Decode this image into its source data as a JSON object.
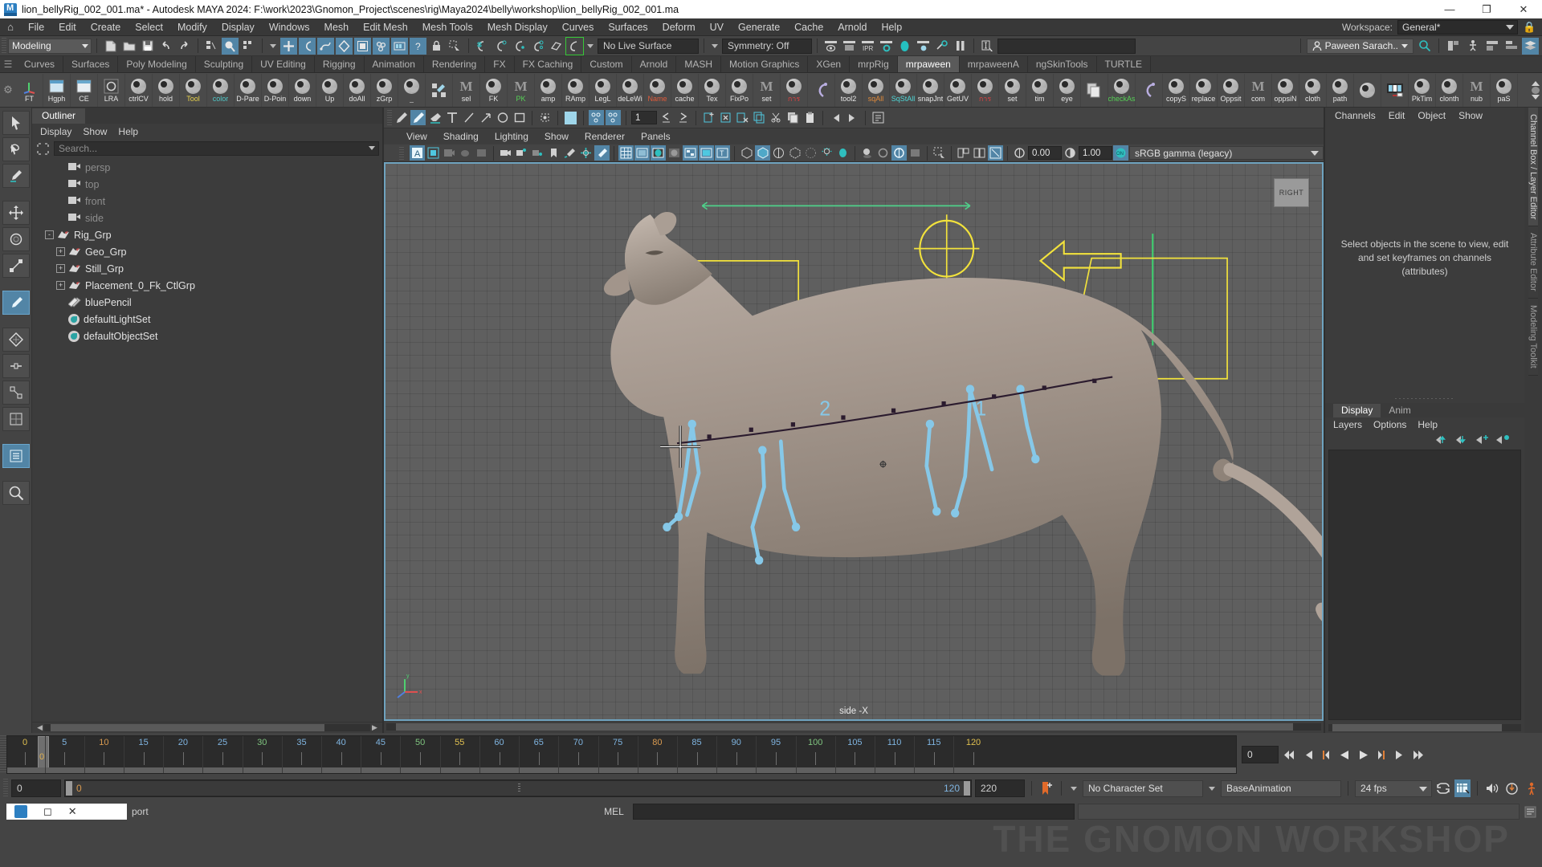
{
  "window": {
    "title": "lion_bellyRig_002_001.ma* - Autodesk MAYA 2024: F:\\work\\2023\\Gnomon_Project\\scenes\\rig\\Maya2024\\belly\\workshop\\lion_bellyRig_002_001.ma",
    "minimize": "—",
    "maximize": "❐",
    "close": "✕",
    "app_icon": "maya-logo-icon"
  },
  "menubar": {
    "home_icon": "home-icon",
    "items": [
      "File",
      "Edit",
      "Create",
      "Select",
      "Modify",
      "Display",
      "Windows",
      "Mesh",
      "Edit Mesh",
      "Mesh Tools",
      "Mesh Display",
      "Curves",
      "Surfaces",
      "Deform",
      "UV",
      "Generate",
      "Cache",
      "Arnold",
      "Help"
    ],
    "workspace_label": "Workspace:",
    "workspace_value": "General*",
    "lock_icon": "lock-icon"
  },
  "statusbar": {
    "mode": "Modeling",
    "live_surface": "No Live Surface",
    "symmetry": "Symmetry: Off",
    "search_value": "",
    "user": "Paween Sarach..",
    "new_icon": "new-scene-icon",
    "open_icon": "open-scene-icon",
    "save_icon": "save-scene-icon",
    "undo_icon": "undo-icon",
    "redo_icon": "redo-icon"
  },
  "shelf": {
    "tabs": [
      "Curves",
      "Surfaces",
      "Poly Modeling",
      "Sculpting",
      "UV Editing",
      "Rigging",
      "Animation",
      "Rendering",
      "FX",
      "FX Caching",
      "Custom",
      "Arnold",
      "MASH",
      "Motion Graphics",
      "XGen",
      "mrpRig",
      "mrpaween",
      "mrpaweenA",
      "ngSkinTools",
      "TURTLE"
    ],
    "active_tab": "mrpaween",
    "buttons": [
      {
        "label": "FT",
        "icon": "axis-icon",
        "color": "#e6e6e6"
      },
      {
        "label": "Hgph",
        "icon": "hypergraph-icon",
        "color": "#e6e6e6"
      },
      {
        "label": "CE",
        "icon": "component-editor-icon",
        "color": "#e6e6e6"
      },
      {
        "label": "LRA",
        "icon": "lra-icon",
        "color": "#e6e6e6"
      },
      {
        "label": "ctrlCV",
        "icon": "maya-script-icon",
        "color": "#e6e6e6"
      },
      {
        "label": "hold",
        "icon": "maya-script-icon",
        "color": "#e6e6e6"
      },
      {
        "label": "Tool",
        "icon": "maya-script-icon",
        "color": "#e8d24a"
      },
      {
        "label": "color",
        "icon": "maya-script-icon",
        "color": "#4fc8c8"
      },
      {
        "label": "D-Pare",
        "icon": "maya-script-icon",
        "color": "#e6e6e6"
      },
      {
        "label": "D-Poin",
        "icon": "maya-script-icon",
        "color": "#e6e6e6"
      },
      {
        "label": "down",
        "icon": "maya-script-icon",
        "color": "#e6e6e6"
      },
      {
        "label": "Up",
        "icon": "maya-script-icon",
        "color": "#e6e6e6"
      },
      {
        "label": "doAll",
        "icon": "maya-script-icon",
        "color": "#e6e6e6"
      },
      {
        "label": "zGrp",
        "icon": "maya-script-icon",
        "color": "#e6e6e6"
      },
      {
        "label": "_",
        "icon": "maya-script-icon",
        "color": "#e6e6e6"
      },
      {
        "label": "",
        "icon": "paint-select-icon",
        "color": "#e6e6e6"
      },
      {
        "label": "sel",
        "icon": "mel-icon",
        "color": "#e6e6e6"
      },
      {
        "label": "FK",
        "icon": "maya-script-icon",
        "color": "#e6e6e6"
      },
      {
        "label": "PK",
        "icon": "mel-icon",
        "color": "#56d156"
      },
      {
        "label": "amp",
        "icon": "maya-script-icon",
        "color": "#e6e6e6"
      },
      {
        "label": "RAmp",
        "icon": "maya-script-icon",
        "color": "#e6e6e6"
      },
      {
        "label": "LegL",
        "icon": "maya-script-icon",
        "color": "#e6e6e6"
      },
      {
        "label": "deLeWi",
        "icon": "maya-script-icon",
        "color": "#e6e6e6"
      },
      {
        "label": "Name",
        "icon": "maya-script-icon",
        "color": "#e05b3a"
      },
      {
        "label": "cache",
        "icon": "maya-script-icon",
        "color": "#e6e6e6"
      },
      {
        "label": "Tex",
        "icon": "maya-script-icon",
        "color": "#e6e6e6"
      },
      {
        "label": "FixPo",
        "icon": "maya-script-icon",
        "color": "#e6e6e6"
      },
      {
        "label": "set",
        "icon": "mel-icon",
        "color": "#e6e6e6"
      },
      {
        "label": "การ",
        "icon": "maya-script-icon",
        "color": "#e04040"
      },
      {
        "label": "",
        "icon": "curve-icon",
        "color": "#e6e6e6"
      },
      {
        "label": "tool2",
        "icon": "maya-script-icon",
        "color": "#e6e6e6"
      },
      {
        "label": "sqAll",
        "icon": "maya-script-icon",
        "color": "#e08a3a"
      },
      {
        "label": "SqStAll",
        "icon": "maya-script-icon",
        "color": "#4fd8d8"
      },
      {
        "label": "snapJnt",
        "icon": "maya-script-icon",
        "color": "#e6e6e6"
      },
      {
        "label": "GetUV",
        "icon": "maya-script-icon",
        "color": "#e6e6e6"
      },
      {
        "label": "การ",
        "icon": "maya-script-icon",
        "color": "#e04040"
      },
      {
        "label": "set",
        "icon": "maya-script-icon",
        "color": "#e6e6e6"
      },
      {
        "label": "tim",
        "icon": "maya-script-icon",
        "color": "#e6e6e6"
      },
      {
        "label": "eye",
        "icon": "maya-script-icon",
        "color": "#e6e6e6"
      },
      {
        "label": "",
        "icon": "copy-icon",
        "color": "#e6e6e6"
      },
      {
        "label": "checkAs",
        "icon": "maya-script-icon",
        "color": "#56d156"
      },
      {
        "label": "",
        "icon": "curve-icon",
        "color": "#e6e6e6"
      },
      {
        "label": "copyS",
        "icon": "maya-script-icon",
        "color": "#e6e6e6"
      },
      {
        "label": "replace",
        "icon": "maya-script-icon",
        "color": "#e6e6e6"
      },
      {
        "label": "Oppsit",
        "icon": "maya-script-icon",
        "color": "#e6e6e6"
      },
      {
        "label": "com",
        "icon": "mel-icon",
        "color": "#e6e6e6"
      },
      {
        "label": "oppsiN",
        "icon": "maya-script-icon",
        "color": "#e6e6e6"
      },
      {
        "label": "cloth",
        "icon": "maya-script-icon",
        "color": "#e6e6e6"
      },
      {
        "label": "path",
        "icon": "maya-script-icon",
        "color": "#e6e6e6"
      },
      {
        "label": "",
        "icon": "maya-script-icon",
        "color": "#e6e6e6"
      },
      {
        "label": "",
        "icon": "film-icon",
        "color": "#e6e6e6"
      },
      {
        "label": "PkTim",
        "icon": "maya-script-icon",
        "color": "#e6e6e6"
      },
      {
        "label": "clonth",
        "icon": "maya-script-icon",
        "color": "#e6e6e6"
      },
      {
        "label": "nub",
        "icon": "mel-icon",
        "color": "#e6e6e6"
      },
      {
        "label": "paS",
        "icon": "maya-script-icon",
        "color": "#e6e6e6"
      }
    ]
  },
  "toolbox": {
    "tools": [
      {
        "name": "select-tool-icon",
        "selected": false
      },
      {
        "name": "lasso-select-tool-icon",
        "selected": false
      },
      {
        "name": "paint-select-tool-icon",
        "selected": false
      },
      {
        "name": "move-tool-icon",
        "selected": false
      },
      {
        "name": "rotate-tool-icon",
        "selected": false
      },
      {
        "name": "scale-tool-icon",
        "selected": false
      },
      {
        "name": "last-tool-icon",
        "selected": true
      },
      {
        "name": "transform-icon",
        "selected": false
      },
      {
        "name": "snap-grid-icon",
        "selected": false
      },
      {
        "name": "snap-curve-icon",
        "selected": false
      },
      {
        "name": "snap-point-icon",
        "selected": false
      },
      {
        "name": "outliner-icon",
        "selected": true
      },
      {
        "name": "magnify-icon",
        "selected": false
      }
    ]
  },
  "outliner": {
    "tab": "Outliner",
    "menus": [
      "Display",
      "Show",
      "Help"
    ],
    "search_placeholder": "Search...",
    "filter_icon": "filter-icon",
    "items": [
      {
        "label": "persp",
        "icon": "camera-icon",
        "indent": 1,
        "dim": true,
        "expander": ""
      },
      {
        "label": "top",
        "icon": "camera-icon",
        "indent": 1,
        "dim": true,
        "expander": ""
      },
      {
        "label": "front",
        "icon": "camera-icon",
        "indent": 1,
        "dim": true,
        "expander": ""
      },
      {
        "label": "side",
        "icon": "camera-icon",
        "indent": 1,
        "dim": true,
        "expander": ""
      },
      {
        "label": "Rig_Grp",
        "icon": "group-icon",
        "indent": 0,
        "dim": false,
        "expander": "-"
      },
      {
        "label": "Geo_Grp",
        "icon": "group-icon",
        "indent": 1,
        "dim": false,
        "expander": "+"
      },
      {
        "label": "Still_Grp",
        "icon": "group-icon",
        "indent": 1,
        "dim": false,
        "expander": "+"
      },
      {
        "label": "Placement_0_Fk_CtlGrp",
        "icon": "group-icon",
        "indent": 1,
        "dim": false,
        "expander": "+"
      },
      {
        "label": "bluePencil",
        "icon": "blue-pencil-icon",
        "indent": 1,
        "dim": false,
        "expander": ""
      },
      {
        "label": "defaultLightSet",
        "icon": "set-icon",
        "indent": 1,
        "dim": false,
        "expander": ""
      },
      {
        "label": "defaultObjectSet",
        "icon": "set-icon",
        "indent": 1,
        "dim": false,
        "expander": ""
      }
    ]
  },
  "viewport": {
    "toolbar_frame_value": "1",
    "menus": [
      "View",
      "Shading",
      "Lighting",
      "Show",
      "Renderer",
      "Panels"
    ],
    "exposure": "0.00",
    "gamma": "1.00",
    "color_space": "sRGB gamma (legacy)",
    "view_cube_label": "RIGHT",
    "camera_label": "side -X"
  },
  "channelbox": {
    "rail_labels": [
      "Channel Box / Layer Editor",
      "Attribute Editor",
      "Modeling Toolkit"
    ],
    "menus": [
      "Channels",
      "Edit",
      "Object",
      "Show"
    ],
    "empty_message": "Select objects in the scene to view, edit and set keyframes on channels (attributes)"
  },
  "layers": {
    "tabs": [
      "Display",
      "Anim"
    ],
    "active_tab": "Display",
    "menus": [
      "Layers",
      "Options",
      "Help"
    ],
    "buttons": [
      "move-layer-up-icon",
      "move-layer-down-icon",
      "new-layer-icon",
      "new-layer-from-selected-icon"
    ]
  },
  "timeline": {
    "ticks": [
      0,
      5,
      10,
      15,
      20,
      25,
      30,
      35,
      40,
      45,
      50,
      55,
      60,
      65,
      70,
      75,
      80,
      85,
      90,
      95,
      100,
      105,
      110,
      115,
      120
    ],
    "current_frame": "0",
    "frame_field": "0",
    "playback_buttons": [
      "go-to-start-icon",
      "step-back-key-icon",
      "step-back-frame-icon",
      "play-backwards-icon",
      "play-forwards-icon",
      "step-forward-frame-icon",
      "step-forward-key-icon",
      "go-to-end-icon"
    ]
  },
  "rangebar": {
    "anim_start": "0",
    "range_start": "0",
    "range_end": "120",
    "anim_end": "220",
    "character_set": "No Character Set",
    "anim_layer": "BaseAnimation",
    "fps": "24 fps",
    "key_icon": "auto-key-icon",
    "loop_icon": "loop-icon",
    "prefs_icon": "animation-prefs-icon",
    "sound_icon": "sound-icon",
    "timeslider_icon": "timeslider-icon",
    "runtime_icon": "runtime-icon"
  },
  "commandline": {
    "label": "MEL",
    "input_value": "",
    "output_value": ""
  },
  "taskbar": {
    "items": [
      "maya-taskbar-icon",
      "restore-icon",
      "close-icon"
    ],
    "partial_text": "port"
  },
  "watermark": "THE GNOMON WORKSHOP"
}
